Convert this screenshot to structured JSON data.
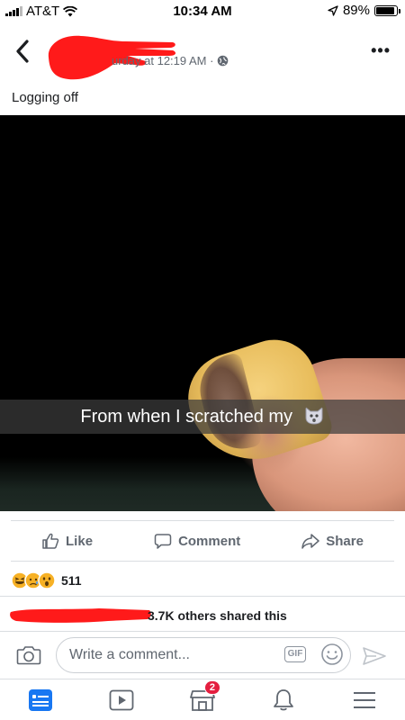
{
  "status_bar": {
    "carrier": "AT&T",
    "time": "10:34 AM",
    "battery": "89%",
    "battery_level": 0.89,
    "icons": [
      "signal-icon",
      "wifi-icon",
      "location-arrow-icon",
      "battery-icon"
    ]
  },
  "post": {
    "timestamp": "urday at 12:19 AM ·",
    "privacy_icon": "globe-icon",
    "text": "Logging off",
    "photo_caption": "From when I scratched my"
  },
  "actions": {
    "like_label": "Like",
    "comment_label": "Comment",
    "share_label": "Share"
  },
  "reactions": {
    "count": "511",
    "icons": [
      "haha-icon",
      "sad-icon",
      "wow-icon"
    ]
  },
  "shares": {
    "text": "3.7K others shared this"
  },
  "comment_box": {
    "placeholder": "Write a comment...",
    "gif_label": "GIF"
  },
  "tabbar": {
    "items": [
      "news-feed-icon",
      "watch-icon",
      "marketplace-icon",
      "notifications-icon",
      "menu-icon"
    ],
    "marketplace_badge": "2"
  },
  "colors": {
    "accent": "#1877f2",
    "redaction": "#ff1a1a",
    "badge": "#e41e3f"
  }
}
